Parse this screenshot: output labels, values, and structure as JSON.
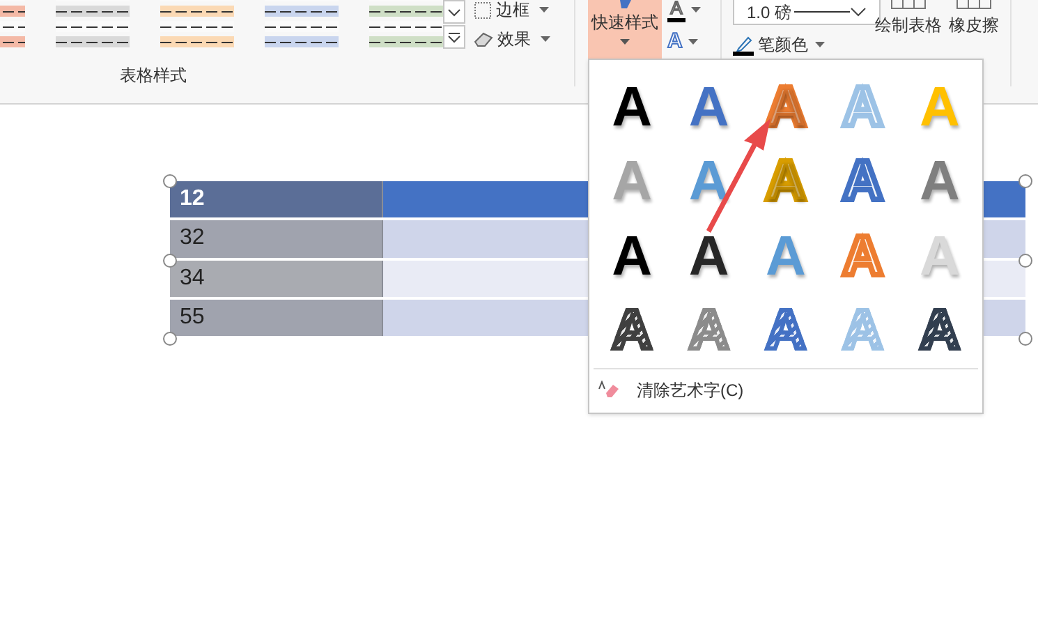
{
  "ribbon": {
    "table_style_swatches": [
      {
        "color": "#f4b9a6"
      },
      {
        "color": "#d9d9d9"
      },
      {
        "color": "#fbd9b4"
      },
      {
        "color": "#c9d5ee"
      },
      {
        "color": "#cfdfc6"
      }
    ],
    "border_button": "边框",
    "effect_button": "效果",
    "group_label": "表格样式",
    "quick_styles_button": {
      "label": "快速样式",
      "selected": true
    },
    "text_fill_button": "A",
    "text_outline_button": "A",
    "pen_weight": {
      "value": "1.0 磅"
    },
    "pen_color_button": "笔颜色",
    "draw_table_button": "绘制表格",
    "eraser_button": "橡皮擦"
  },
  "table": {
    "rows": [
      [
        "12",
        ""
      ],
      [
        "32",
        ""
      ],
      [
        "34",
        ""
      ],
      [
        "55",
        ""
      ]
    ]
  },
  "wordart_gallery": {
    "items": [
      {
        "label": "A",
        "kind": "solid",
        "color": "#000000"
      },
      {
        "label": "A",
        "kind": "solid",
        "color": "#4472c4"
      },
      {
        "label": "A",
        "kind": "tinted",
        "color": "#ed7d31"
      },
      {
        "label": "A",
        "kind": "outline",
        "color": "#9dc3e6"
      },
      {
        "label": "A",
        "kind": "solid",
        "color": "#ffc000"
      },
      {
        "label": "A",
        "kind": "solid",
        "color": "#a6a6a6"
      },
      {
        "label": "A",
        "kind": "solid",
        "color": "#5b9bd5"
      },
      {
        "label": "A",
        "kind": "tinted",
        "color": "#d99e00"
      },
      {
        "label": "A",
        "kind": "outline",
        "color": "#4472c4"
      },
      {
        "label": "A",
        "kind": "solid",
        "color": "#7f7f7f"
      },
      {
        "label": "A",
        "kind": "solid",
        "color": "#000000"
      },
      {
        "label": "A",
        "kind": "solid",
        "color": "#262626"
      },
      {
        "label": "A",
        "kind": "solid",
        "color": "#5b9bd5"
      },
      {
        "label": "A",
        "kind": "outline",
        "color": "#ed7d31"
      },
      {
        "label": "A",
        "kind": "solid",
        "color": "#d9d9d9"
      },
      {
        "label": "A",
        "kind": "striped",
        "color": "#404040"
      },
      {
        "label": "A",
        "kind": "striped",
        "color": "#8c8c8c"
      },
      {
        "label": "A",
        "kind": "striped",
        "color": "#4472c4"
      },
      {
        "label": "A",
        "kind": "striped",
        "color": "#9dc3e6"
      },
      {
        "label": "A",
        "kind": "striped",
        "color": "#333f50"
      }
    ],
    "clear_item": "清除艺术字(C)"
  }
}
